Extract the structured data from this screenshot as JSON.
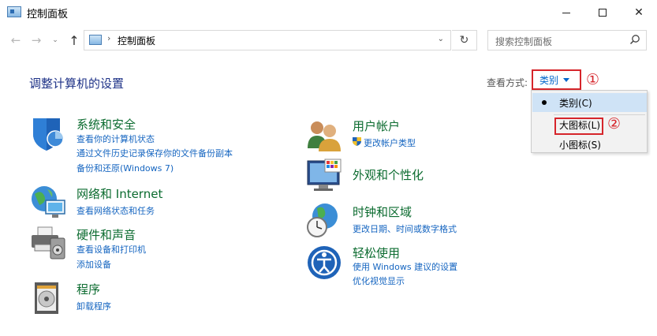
{
  "window": {
    "title": "控制面板",
    "minimize": "—",
    "close": "✕"
  },
  "nav": {
    "back": "←",
    "forward": "→",
    "recent": "⌄",
    "up": "↑",
    "address_separator": "›",
    "address": "控制面板",
    "address_dropdown": "⌄",
    "refresh": "↻",
    "search_placeholder": "搜索控制面板"
  },
  "header": {
    "title": "调整计算机的设置",
    "view_by_label": "查看方式:",
    "view_by_value": "类别"
  },
  "view_menu": {
    "items": [
      {
        "label": "类别(C)",
        "selected": true
      },
      {
        "label": "大图标(L)"
      },
      {
        "label": "小图标(S)"
      }
    ]
  },
  "annotations": {
    "step1": "①",
    "step2": "②"
  },
  "categories": {
    "left": [
      {
        "title": "系统和安全",
        "links": [
          "查看你的计算机状态",
          "通过文件历史记录保存你的文件备份副本",
          "备份和还原(Windows 7)"
        ]
      },
      {
        "title": "网络和 Internet",
        "links": [
          "查看网络状态和任务"
        ]
      },
      {
        "title": "硬件和声音",
        "links": [
          "查看设备和打印机",
          "添加设备"
        ]
      },
      {
        "title": "程序",
        "links": [
          "卸载程序"
        ]
      }
    ],
    "right": [
      {
        "title": "用户帐户",
        "links": [
          "更改帐户类型"
        ]
      },
      {
        "title": "外观和个性化",
        "links": []
      },
      {
        "title": "时钟和区域",
        "links": [
          "更改日期、时间或数字格式"
        ]
      },
      {
        "title": "轻松使用",
        "links": [
          "使用 Windows 建议的设置",
          "优化视觉显示"
        ]
      }
    ]
  },
  "colors": {
    "accent_link": "#1565c0",
    "category_title": "#0b6b2f",
    "annotation_red": "#d6252b",
    "heading": "#1e3287"
  }
}
